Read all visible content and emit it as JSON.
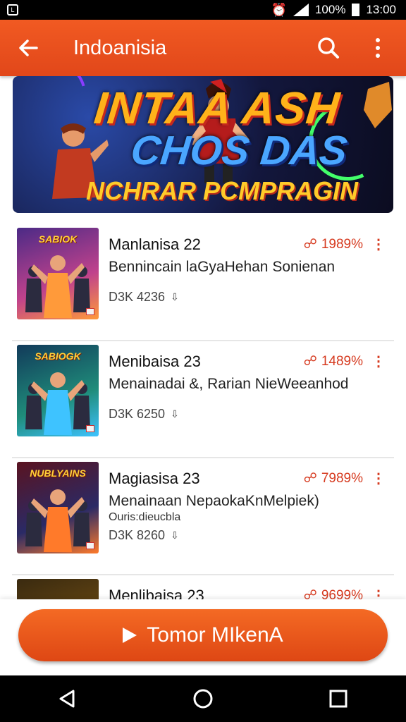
{
  "status_bar": {
    "battery": "100%",
    "time": "13:00"
  },
  "app_bar": {
    "title": "Indoanisia",
    "back_icon": "arrow-left-icon",
    "search_icon": "search-icon",
    "menu_icon": "more-vertical-icon"
  },
  "banner": {
    "line1": "INTAA ASH",
    "line2": "CHOS DAS",
    "line3": "NCHRAR PCMPRAGIN"
  },
  "items": [
    {
      "name": "Manlanisa 22",
      "desc": "Bennincain laGyaHehan Sonienan",
      "subdesc": "",
      "downloads": "D3K 4236",
      "rating": "1989%",
      "thumb_title": "SABIOK",
      "thumb_colors": [
        "#4b2a86",
        "#c0428c",
        "#ff9a3a"
      ]
    },
    {
      "name": "Menibaisa 23",
      "desc": "Menainadai &, Rarian NieWeeanhod",
      "subdesc": "",
      "downloads": "D3K 6250",
      "rating": "1489%",
      "thumb_title": "SABIOGK",
      "thumb_colors": [
        "#123a5a",
        "#1f8c7a",
        "#3ec3ff"
      ]
    },
    {
      "name": "Magiasisa 23",
      "desc": "Menainaan NepaokaKnMelpiek)",
      "subdesc": "Ouris:dieucbla",
      "downloads": "D3K 8260",
      "rating": "7989%",
      "thumb_title": "NUBLYAINS",
      "thumb_colors": [
        "#5a1320",
        "#2a2a66",
        "#ff7a2a"
      ]
    },
    {
      "name": "Menlibaisa 23",
      "desc": "",
      "subdesc": "",
      "downloads": "",
      "rating": "9699%",
      "thumb_title": "",
      "thumb_colors": [
        "#3a2a10",
        "#6b4a12",
        "#ffb12a"
      ]
    }
  ],
  "cta": {
    "label": "Tomor MIkenA",
    "icon": "play-icon"
  },
  "nav_bar": {
    "back_icon": "nav-back-icon",
    "home_icon": "nav-home-icon",
    "recents_icon": "nav-recents-icon"
  },
  "colors": {
    "accent": "#f15a22",
    "rating": "#d63a1f"
  }
}
